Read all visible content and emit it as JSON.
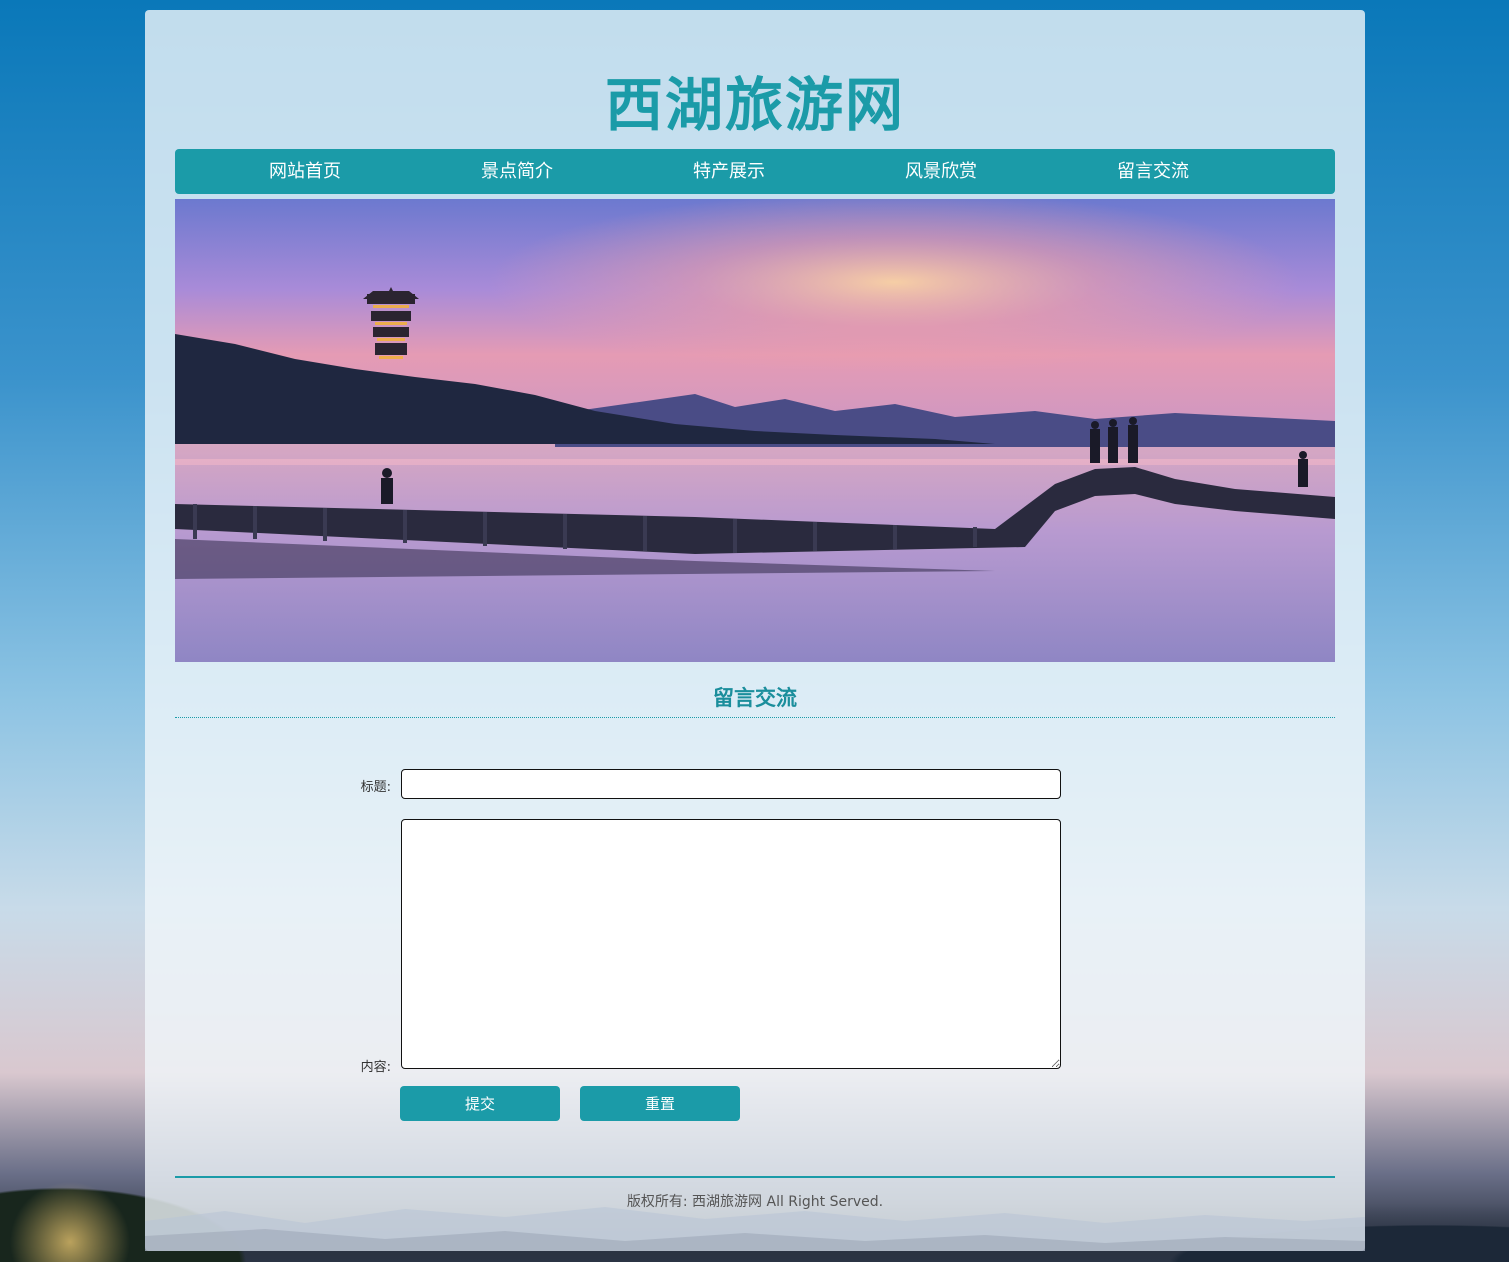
{
  "site": {
    "logo": "西湖旅游网"
  },
  "nav": {
    "items": [
      {
        "label": "网站首页"
      },
      {
        "label": "景点简介"
      },
      {
        "label": "特产展示"
      },
      {
        "label": "风景欣赏"
      },
      {
        "label": "留言交流"
      }
    ]
  },
  "page": {
    "section_title": "留言交流"
  },
  "form": {
    "title_label": "标题:",
    "content_label": "内容:",
    "title_value": "",
    "content_value": "",
    "submit_label": "提交",
    "reset_label": "重置"
  },
  "footer": {
    "copyright": "版权所有: 西湖旅游网 All Right Served."
  },
  "colors": {
    "accent": "#1b9ba8",
    "nav_text": "#ffffff"
  }
}
